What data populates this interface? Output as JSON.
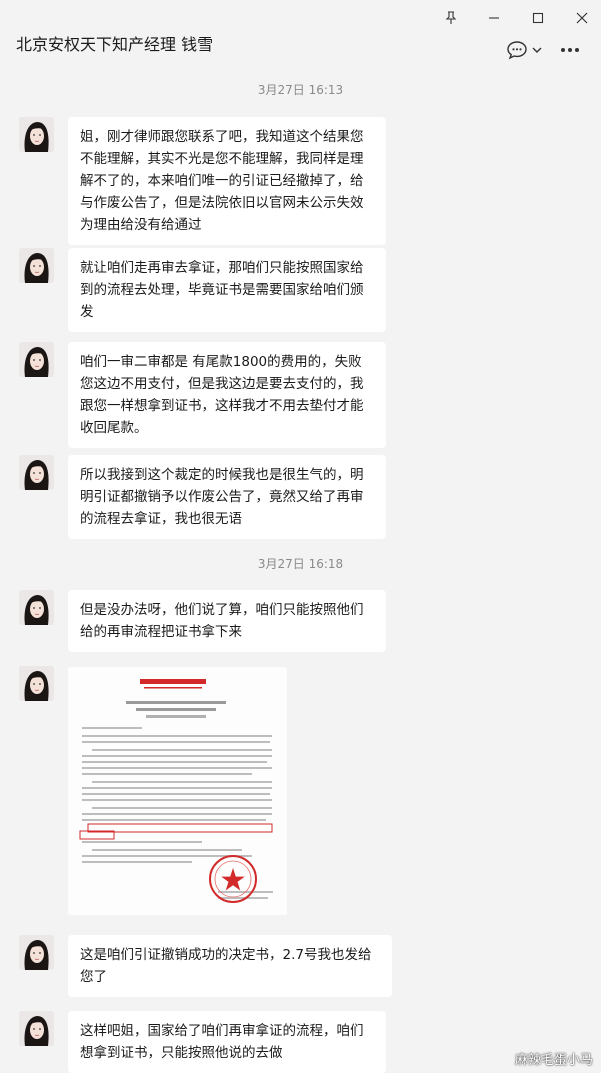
{
  "window": {
    "title": "北京安权天下知产经理 钱雪"
  },
  "colors": {
    "background": "#f3f3f3",
    "bubble": "#ffffff",
    "stamp": "#d22a2a"
  },
  "timestamps": [
    "3月27日 16:13",
    "3月27日 16:18"
  ],
  "messages": [
    {
      "text": "姐，刚才律师跟您联系了吧，我知道这个结果您不能理解，其实不光是您不能理解，我同样是理解不了的，本来咱们唯一的引证已经撤掉了，给与作废公告了，但是法院依旧以官网未公示失效为理由给没有给通过"
    },
    {
      "text": "就让咱们走再审去拿证，那咱们只能按照国家给到的流程去处理，毕竟证书是需要国家给咱们颁发"
    },
    {
      "text": "咱们一审二审都是 有尾款1800的费用的，失败您这边不用支付，但是我这边是要去支付的，我跟您一样想拿到证书，这样我才不用去垫付才能收回尾款。"
    },
    {
      "text": "所以我接到这个裁定的时候我也是很生气的，明明引证都撤销予以作废公告了，竟然又给了再审的流程去拿证，我也很无语"
    },
    {
      "text": "但是没办法呀，他们说了算，咱们只能按照他们给的再审流程把证书拿下来"
    },
    {
      "text": "这是咱们引证撤销成功的决定书，2.7号我也发给您了"
    },
    {
      "text": "这样吧姐，国家给了咱们再审拿证的流程，咱们想拿到证书，只能按照他说的去做"
    }
  ],
  "watermark": "麻辣毛蛋小马"
}
